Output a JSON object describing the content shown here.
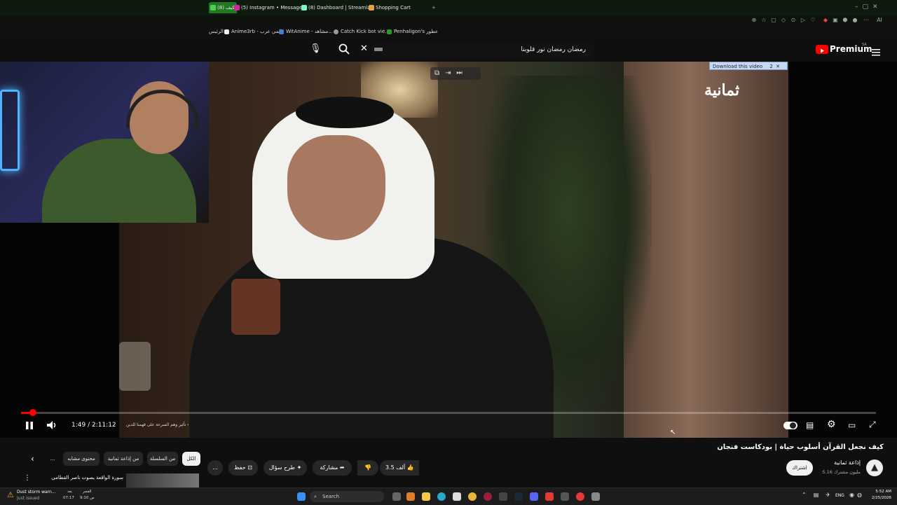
{
  "browser": {
    "tabs": [
      {
        "label": "كيف (8)",
        "color": "#3a9a3a"
      },
      {
        "label": "(5) Instagram • Messages",
        "color": "#d6249f"
      },
      {
        "label": "(8) Dashboard | Streamlabs",
        "color": "#80f5d2"
      },
      {
        "label": "Shopping Cart",
        "color": "#e8a33c"
      }
    ],
    "new_tab": "+",
    "bookmarks": [
      {
        "label": "الرئيس"
      },
      {
        "label": "Anime3rb - انمي عرب"
      },
      {
        "label": "WitAnime - مشاهد..."
      },
      {
        "label": "Catch Kick bot vie..."
      },
      {
        "label": "Penhaligon's عطور"
      }
    ]
  },
  "youtube": {
    "search_value": "رمضان رمضان نور قلوبنا",
    "logo": "Premium",
    "logo_region": "SA",
    "download_badge": "Download this video",
    "download_badge_count": "2"
  },
  "video": {
    "channel_watermark": "ثمانية",
    "time_current": "1:49",
    "time_total": "2:11:12",
    "time_display": "1:49 / 2:11:12",
    "chapter": "تأثير وهم السرعة على فهمنا للدين",
    "progress": 0.014
  },
  "meta": {
    "title": "كيف نجعل القرآن أسلوب حياة | بودكاست فنجان",
    "channel_name": "إذاعة ثمانية",
    "subscribers": "5.16 مليون مشترك",
    "subscribe_label": "اشتراك",
    "like_count": "3.5 ألف",
    "share_label": "مشاركة",
    "ask_label": "طرح سؤال",
    "save_label": "حفظ",
    "more_label": "..."
  },
  "chips": [
    {
      "label": "الكل"
    },
    {
      "label": "من السلسلة"
    },
    {
      "label": "من إذاعة ثمانية"
    },
    {
      "label": "محتوى مشابه"
    },
    {
      "label": "..."
    }
  ],
  "related": {
    "title": "سورة الواقعة بصوت ناصر القطامي"
  },
  "taskbar": {
    "weather_title": "Dust storm warn...",
    "weather_sub": "Just issued",
    "prayer_name": "الفجر",
    "prayer_time": "07:17",
    "next_label": "بعد",
    "next_time": "9:10 ص",
    "search_placeholder": "Search",
    "lang": "ENG",
    "clock_time": "5:52 AM",
    "clock_date": "2/25/2026"
  },
  "colors": {
    "accent_red": "#ff0000",
    "bg": "#0f0f0f",
    "chip_bg": "#272727"
  }
}
